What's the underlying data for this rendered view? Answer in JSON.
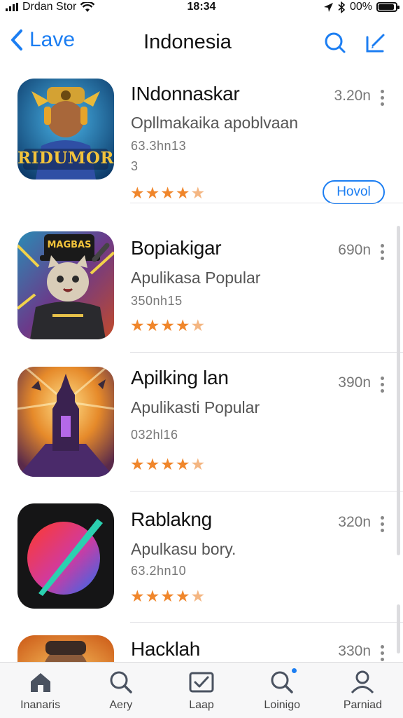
{
  "status_bar": {
    "carrier": "Drdan Stor",
    "time": "18:34",
    "battery": "00%",
    "battery_level": 0.9
  },
  "nav": {
    "back_label": "Lave",
    "title": "Indonesia"
  },
  "apps": [
    {
      "name": "INdonnaskar",
      "subtitle": "Opllmakaika apoblvaan",
      "meta": "63.3hn13",
      "meta2": "3",
      "size": "3.20n",
      "rating": 4.5,
      "button_label": "Hovol",
      "icon": "warrior-game-icon",
      "icon_text": "RIDUMOR"
    },
    {
      "name": "Bopiakigar",
      "subtitle": "Apulikasa Popular",
      "meta": "350nh15",
      "size": "690n",
      "rating": 4.5,
      "icon": "cat-hero-icon",
      "icon_text": "MAGBAS"
    },
    {
      "name": "Apilking lan",
      "subtitle": "Apulikasti Popular",
      "meta": "032hl16",
      "size": "390n",
      "rating": 4.5,
      "icon": "dark-castle-icon"
    },
    {
      "name": "Rablakng",
      "subtitle": "Apulkasu bory.",
      "meta": "63.2hn10",
      "size": "320n",
      "rating": 4.5,
      "icon": "planet-slash-icon"
    },
    {
      "name": "Hacklah",
      "size": "330n",
      "icon": "character-face-icon"
    }
  ],
  "tabs": [
    {
      "label": "Inanaris",
      "icon": "home-icon"
    },
    {
      "label": "Aery",
      "icon": "search-icon"
    },
    {
      "label": "Laap",
      "icon": "tray-check-icon"
    },
    {
      "label": "Loinigo",
      "icon": "search-dot-icon"
    },
    {
      "label": "Parniad",
      "icon": "person-icon"
    }
  ],
  "colors": {
    "accent": "#1c7ef2",
    "star": "#f0862b",
    "star_partial": "#f4b682",
    "tabbar_bg": "#f7f7f8"
  }
}
